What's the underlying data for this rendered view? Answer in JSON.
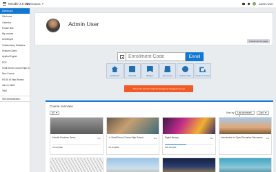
{
  "navbar": {
    "brand": "Moodle 3.6 DEV",
    "my_classes": "My Classes",
    "user_name": "Admin User"
  },
  "sidebar": {
    "items": [
      {
        "label": "Dashboard",
        "active": true
      },
      {
        "label": "Site home"
      },
      {
        "label": "Calendar"
      },
      {
        "label": "Private files"
      },
      {
        "label": "My courses"
      },
      {
        "label": "AODUtoyot"
      },
      {
        "label": "Collaboratory Database"
      },
      {
        "label": "Features Demo"
      },
      {
        "label": "Applied English"
      },
      {
        "label": "PDP"
      },
      {
        "label": "Small Demo Course High School"
      },
      {
        "label": "New Course"
      },
      {
        "label": "HS 5S M Step Review"
      },
      {
        "label": "Intro to Skills"
      },
      {
        "label": "Talk1"
      },
      {
        "label": "Site administration"
      }
    ]
  },
  "profile": {
    "name": "Admin User",
    "customise_label": "Customise this page"
  },
  "enroll": {
    "placeholder": "Enrollment Code",
    "button_label": "Enroll"
  },
  "shortcuts": [
    {
      "label": "Dashboard",
      "icon": "home-icon"
    },
    {
      "label": "Calendar",
      "icon": "calendar-icon"
    },
    {
      "label": "Badges",
      "icon": "badge-icon"
    },
    {
      "label": "All Courses",
      "icon": "courses-icon"
    },
    {
      "label": "Teacher Help",
      "icon": "help-icon"
    },
    {
      "label": "Create a Course",
      "icon": "create-course-icon"
    }
  ],
  "alert": {
    "text": "This is the alert box that should appear if logged in as ad"
  },
  "overview": {
    "title": "Course overview",
    "filter": "All",
    "sort_label": "Sort by",
    "sort_value": "Last accessed",
    "view_value": "Card"
  },
  "courses": [
    {
      "name": "Moodle Features Demo",
      "starred": false,
      "progress": 0,
      "progress_label": "0% complete"
    },
    {
      "name": "Small Demo Course High School",
      "starred": true,
      "progress": 0,
      "progress_label": "0% complete"
    },
    {
      "name": "Digital literacy",
      "starred": false,
      "progress": 44,
      "progress_label": "44% complete"
    },
    {
      "name": "Introduction to Open Education Resources",
      "starred": false,
      "progress": 0,
      "progress_label": ""
    }
  ],
  "colors": {
    "accent": "#1177d1",
    "alert": "#f15a24"
  }
}
